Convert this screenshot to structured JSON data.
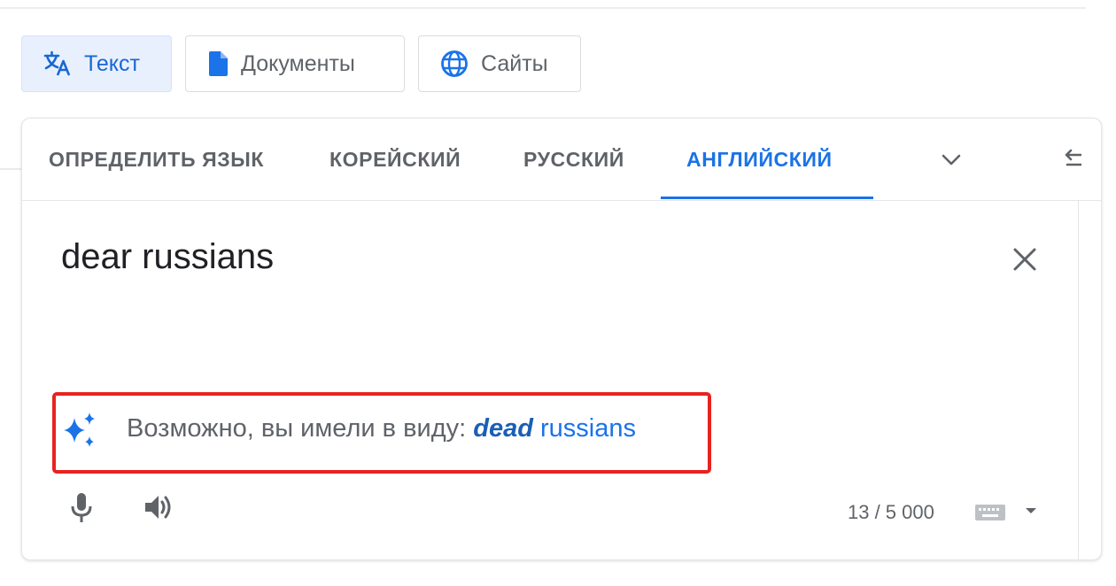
{
  "modes": {
    "text": {
      "label": "Текст",
      "icon": "translate-icon",
      "active": true
    },
    "documents": {
      "label": "Документы",
      "icon": "document-icon"
    },
    "sites": {
      "label": "Сайты",
      "icon": "globe-icon"
    }
  },
  "languages": {
    "tabs": [
      {
        "label": "ОПРЕДЕЛИТЬ ЯЗЫК"
      },
      {
        "label": "КОРЕЙСКИЙ"
      },
      {
        "label": "РУССКИЙ"
      },
      {
        "label": "АНГЛИЙСКИЙ",
        "selected": true
      }
    ],
    "more_icon": "chevron-down-icon",
    "swap_icon": "swap-icon"
  },
  "source": {
    "text": "dear russians",
    "clear_icon": "close-icon"
  },
  "suggestion": {
    "icon": "sparkle-icon",
    "prefix": "Возможно, вы имели в виду:",
    "corrected_word": "dead",
    "rest": "russians",
    "highlight_color": "#e8231f"
  },
  "footer": {
    "mic_icon": "mic-icon",
    "speaker_icon": "speaker-icon",
    "char_count": "13 / 5 000",
    "keyboard_icon": "keyboard-icon",
    "caret_icon": "caret-down-icon"
  },
  "colors": {
    "accent": "#1a73e8",
    "active_bg": "#e8f0fe",
    "text_muted": "#5f6368"
  }
}
